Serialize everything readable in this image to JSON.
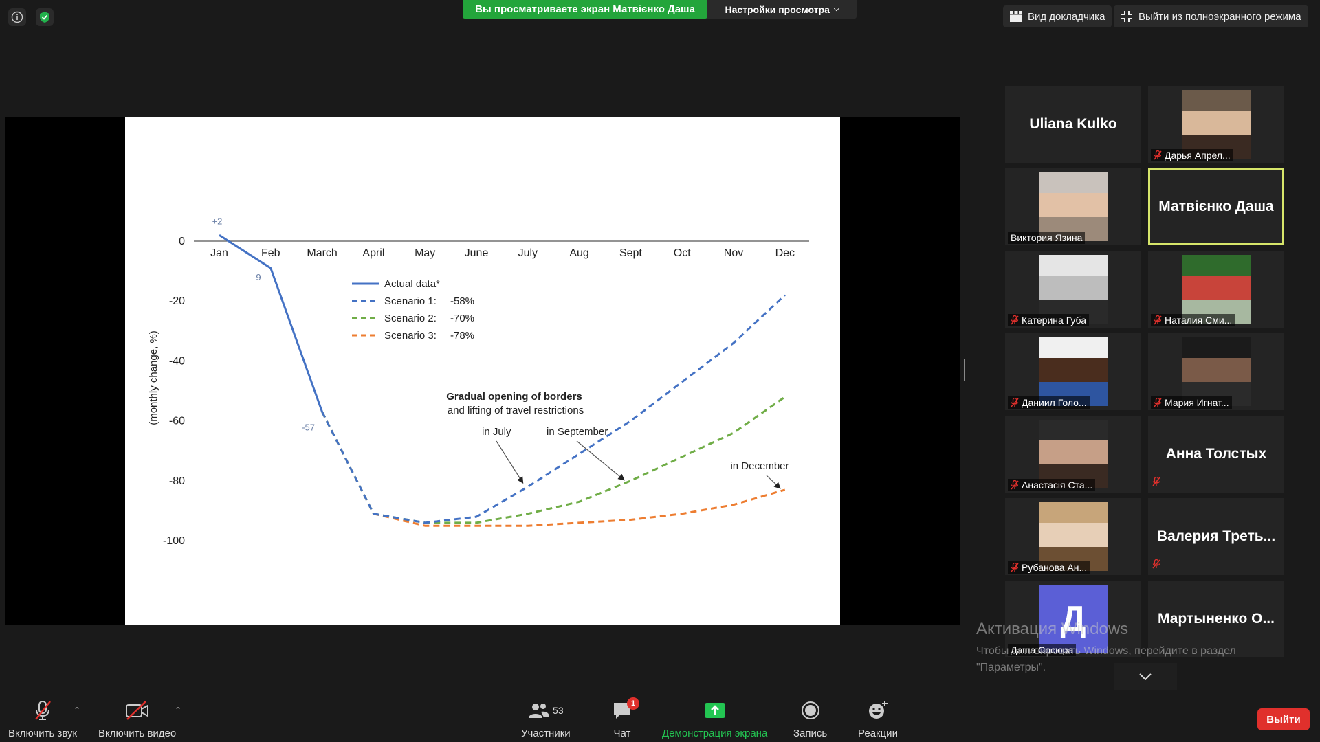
{
  "top": {
    "share_banner": "Вы просматриваете экран Матвієнко Даша",
    "view_options": "Настройки просмотра",
    "speaker_view": "Вид докладчика",
    "exit_fullscreen": "Выйти из полноэкранного режима"
  },
  "participants": [
    {
      "name": "Uliana Kulko",
      "video": false,
      "muted": false
    },
    {
      "name": "Дарья Апрел...",
      "video": true,
      "muted": true
    },
    {
      "name": "Виктория Язина",
      "video": true,
      "muted": false
    },
    {
      "name": "Матвієнко Даша",
      "video": false,
      "muted": false,
      "active_speaker": true
    },
    {
      "name": "Катерина Губа",
      "video": true,
      "muted": true
    },
    {
      "name": "Наталия Сми...",
      "video": true,
      "muted": true
    },
    {
      "name": "Даниил Голо...",
      "video": true,
      "muted": true
    },
    {
      "name": "Мария Игнат...",
      "video": true,
      "muted": true
    },
    {
      "name": "Анастасія Ста...",
      "video": true,
      "muted": true
    },
    {
      "name": "Анна Толстых",
      "video": false,
      "muted": true
    },
    {
      "name": "Рубанова Ан...",
      "video": true,
      "muted": true
    },
    {
      "name": "Валерия  Треть...",
      "video": false,
      "muted": true
    },
    {
      "name": "Даша Сосюра",
      "video": false,
      "avatar_letter": "Д",
      "muted": false
    },
    {
      "name": "Мартыненко  О...",
      "video": false,
      "muted": false
    }
  ],
  "windows_activation": {
    "title": "Активация Windows",
    "line1": "Чтобы активировать Windows, перейдите в раздел",
    "line2": "\"Параметры\"."
  },
  "toolbar": {
    "mute": "Включить звук",
    "video": "Включить видео",
    "participants": "Участники",
    "participants_count": "53",
    "chat": "Чат",
    "chat_badge": "1",
    "share": "Демонстрация экрана",
    "record": "Запись",
    "reactions": "Реакции",
    "leave": "Выйти"
  },
  "chart_data": {
    "type": "line",
    "ylabel": "(monthly change, %)",
    "categories": [
      "Jan",
      "Feb",
      "March",
      "April",
      "May",
      "June",
      "July",
      "Aug",
      "Sept",
      "Oct",
      "Nov",
      "Dec"
    ],
    "y_ticks": [
      "0",
      "-20",
      "-40",
      "-60",
      "-80",
      "-100"
    ],
    "ylim": [
      -100,
      5
    ],
    "series": [
      {
        "name": "Actual data*",
        "value_label": "",
        "color": "#4472c4",
        "dash": false,
        "values": [
          2,
          -9,
          -57,
          null,
          null,
          null,
          null,
          null,
          null,
          null,
          null,
          null
        ]
      },
      {
        "name": "Scenario 1:",
        "value_label": "-58%",
        "color": "#4472c4",
        "dash": true,
        "values": [
          null,
          null,
          -57,
          -91,
          -94,
          -92,
          -82,
          -71,
          -60,
          -47,
          -34,
          -18
        ]
      },
      {
        "name": "Scenario 2:",
        "value_label": "-70%",
        "color": "#70ad47",
        "dash": true,
        "values": [
          null,
          null,
          -57,
          -91,
          -94,
          -94,
          -91,
          -87,
          -80,
          -72,
          -64,
          -52
        ]
      },
      {
        "name": "Scenario 3:",
        "value_label": "-78%",
        "color": "#ed7d31",
        "dash": true,
        "values": [
          null,
          null,
          -57,
          -91,
          -95,
          -95,
          -95,
          -94,
          -93,
          -91,
          -88,
          -83
        ]
      }
    ],
    "point_labels": [
      {
        "text": "+2",
        "x": "Jan",
        "y": 2
      },
      {
        "text": "-9",
        "x": "Feb",
        "y": -9
      },
      {
        "text": "-57",
        "x": "March",
        "y": -57
      }
    ],
    "annotation_title": "Gradual opening of borders",
    "annotation_sub": "and lifting of travel restrictions",
    "annotations": [
      {
        "text": "in July",
        "target_x": "July",
        "target_y": -82
      },
      {
        "text": "in September",
        "target_x": "Sept",
        "target_y": -80
      },
      {
        "text": "in December",
        "target_x": "Dec",
        "target_y": -83
      }
    ]
  }
}
